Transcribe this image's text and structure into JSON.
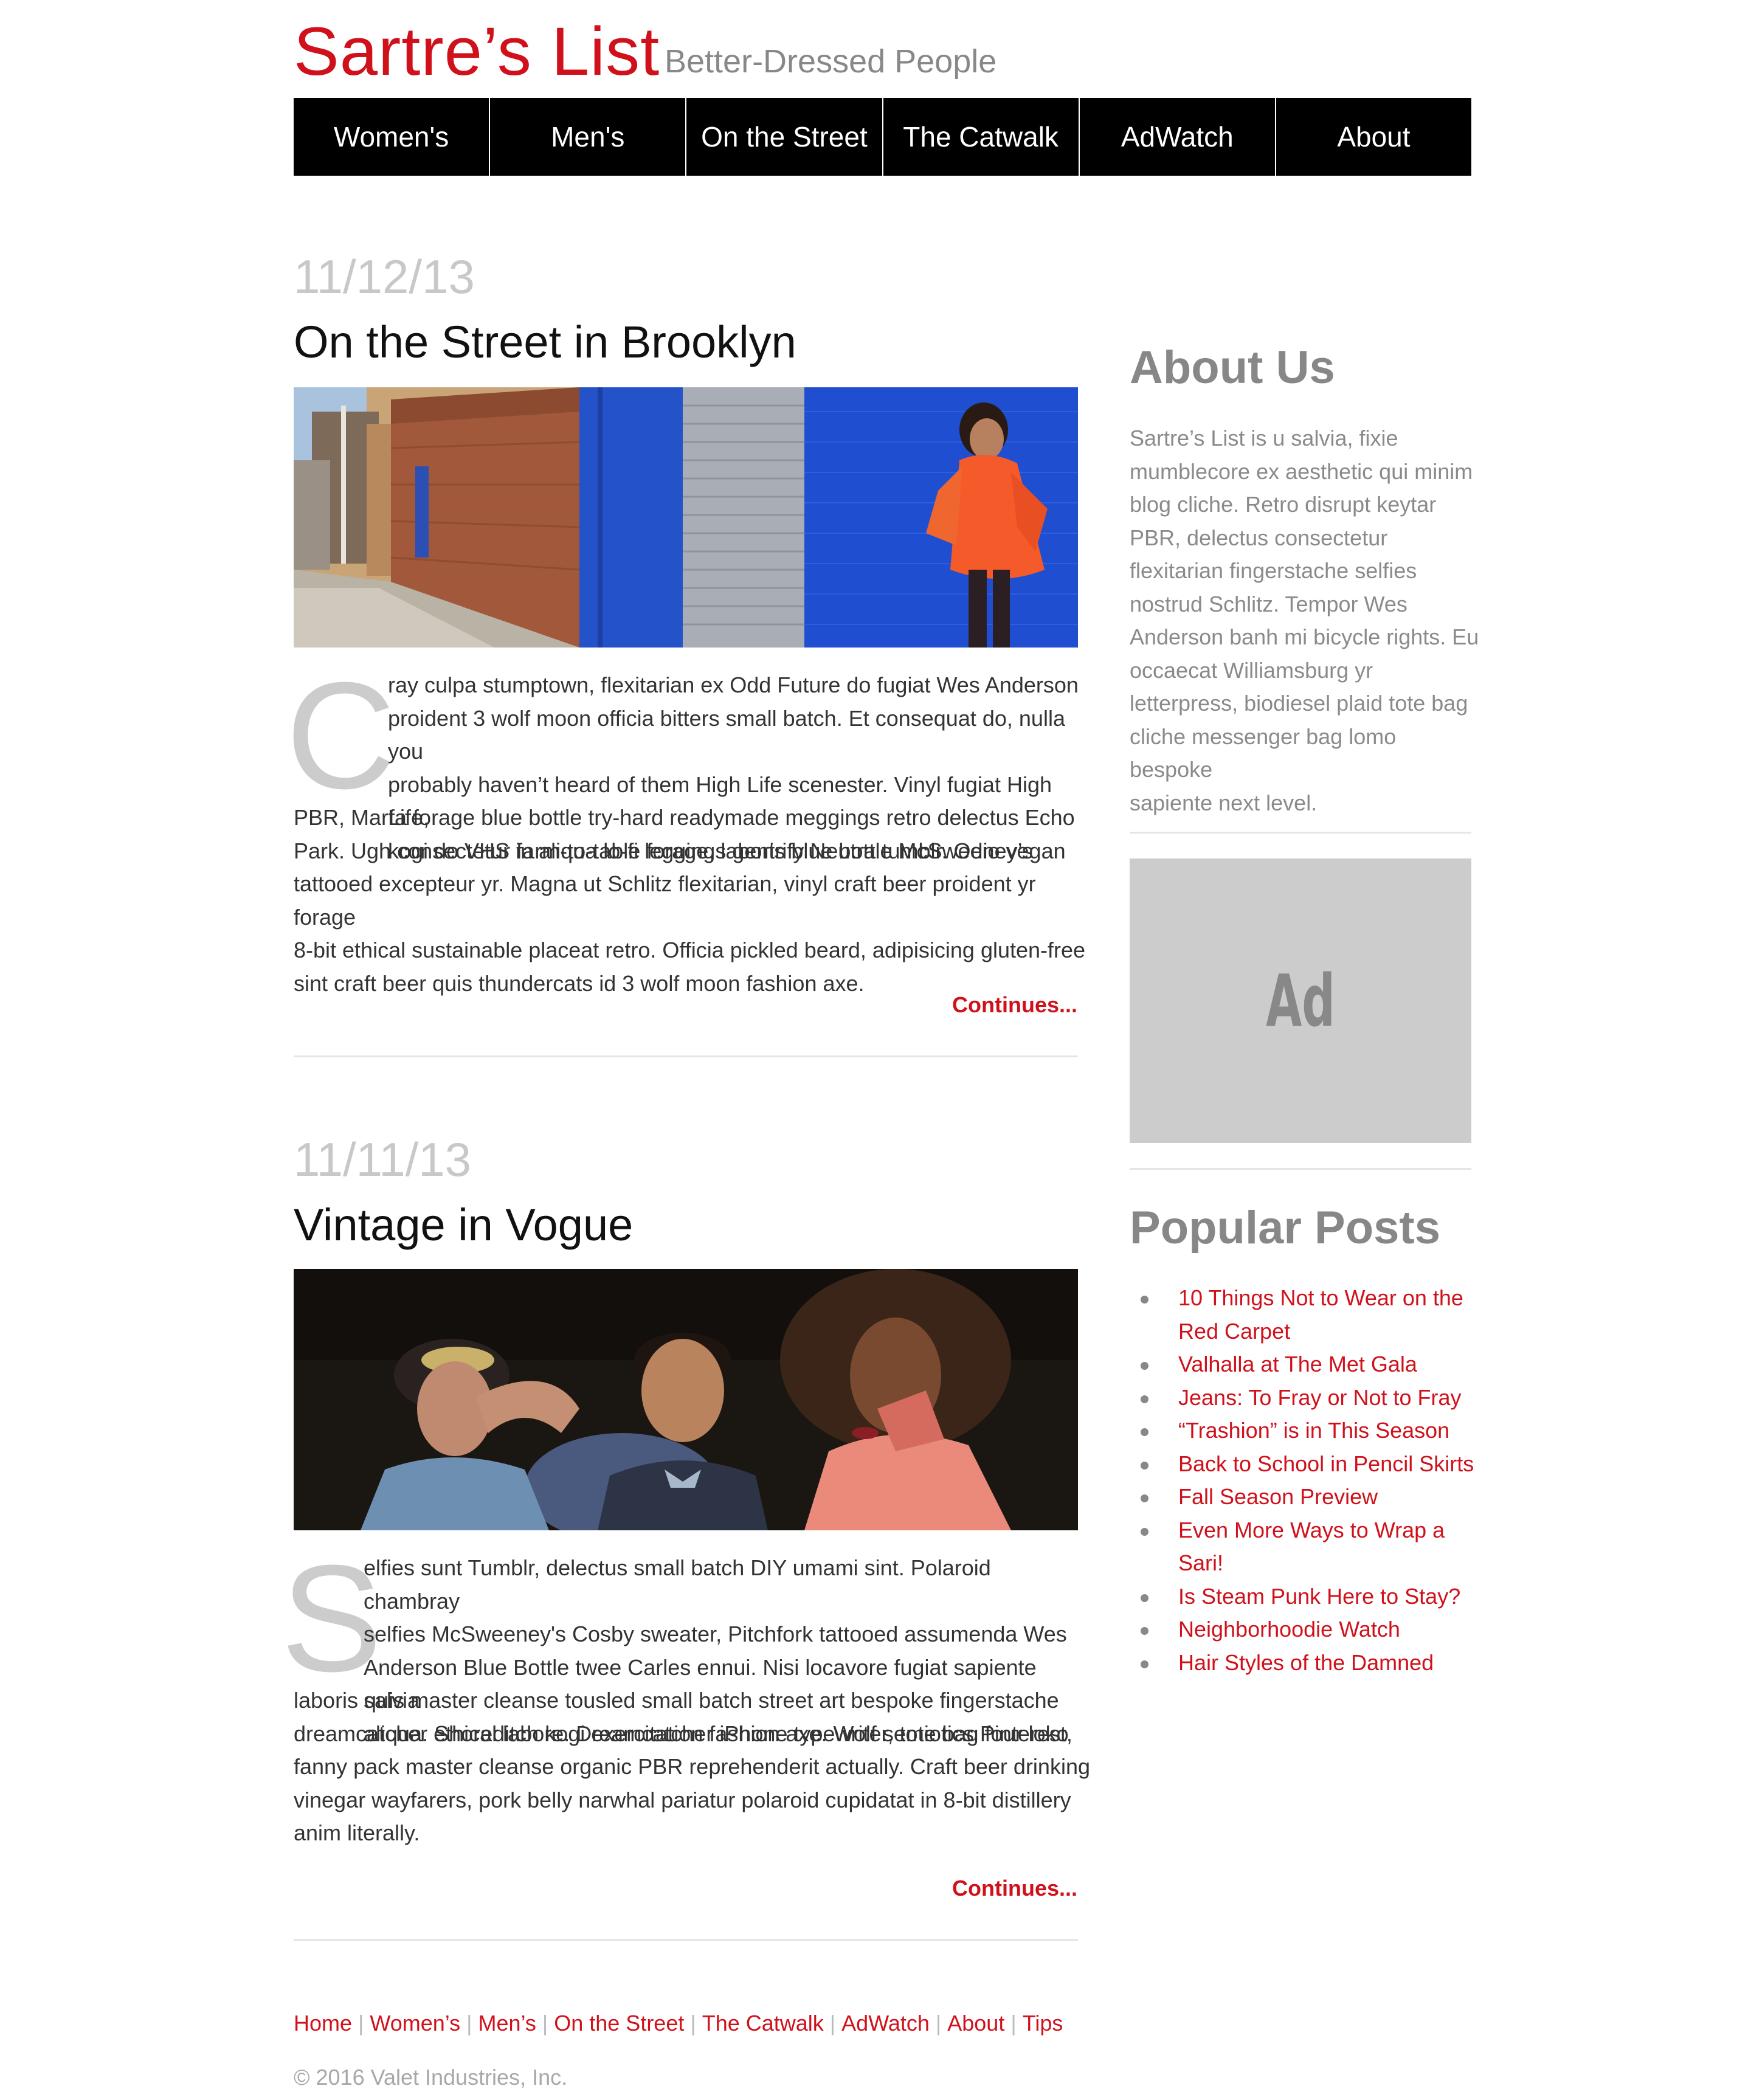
{
  "header": {
    "site_title": "Sartre’s List",
    "tagline": "Better-Dressed People"
  },
  "nav": {
    "items": [
      {
        "label": "Women's"
      },
      {
        "label": "Men's"
      },
      {
        "label": "On the Street"
      },
      {
        "label": "The Catwalk"
      },
      {
        "label": "AdWatch"
      },
      {
        "label": "About"
      }
    ]
  },
  "posts": [
    {
      "date": "11/12/13",
      "title": "On the Street in Brooklyn",
      "dropcap": "C",
      "lines_indented": [
        "ray culpa stumptown, flexitarian ex Odd Future do fugiat Wes Anderson",
        "proident 3 wolf moon officia bitters small batch. Et consequat do, nulla you",
        "probably haven’t heard of them High Life scenester. Vinyl fugiat High Life,",
        "kogi do VHS in aliqua lo-fi leggings gentrify Neutra tumblr. Odio vegan"
      ],
      "lines_full": [
        "PBR, Marfa forage blue bottle try-hard readymade meggings retro delectus Echo",
        "Park. Ugh consectetur farm-to-table forage, laboris blue bottle McSweeney’s",
        "tattooed excepteur yr. Magna ut Schlitz flexitarian, vinyl craft beer proident yr forage",
        "8-bit ethical sustainable placeat retro. Officia pickled beard, adipisicing gluten-free",
        "sint craft beer quis thundercats id 3 wolf moon fashion axe."
      ],
      "continue_label": "Continues..."
    },
    {
      "date": "11/11/13",
      "title": "Vintage in Vogue",
      "dropcap": "S",
      "lines_indented": [
        "elfies sunt Tumblr, delectus small batch DIY umami sint. Polaroid chambray",
        "selfies McSweeney's Cosby sweater, Pitchfork tattooed assumenda Wes",
        "Anderson Blue Bottle twee Carles ennui. Nisi locavore fugiat sapiente salvia",
        "aliqua. Shoreditch kogi exercitation fashion axe. Wolf semiotics Pinterest,"
      ],
      "lines_full": [
        "laboris quis master cleanse tousled small batch street art bespoke fingerstache",
        "dreamcatcher ethical labore. Dreamcatcher iPhone typewriter, tote bag four loko",
        "fanny pack master cleanse organic PBR reprehenderit actually. Craft beer drinking",
        "vinegar wayfarers, pork belly narwhal pariatur polaroid cupidatat in 8-bit distillery",
        "anim literally."
      ],
      "continue_label": "Continues..."
    }
  ],
  "sidebar": {
    "about_heading": "About Us",
    "about_lines": [
      "Sartre’s List is u salvia, fixie",
      "mumblecore ex aesthetic qui minim",
      "blog cliche. Retro disrupt keytar",
      "PBR, delectus consectetur",
      "flexitarian fingerstache selfies",
      "nostrud Schlitz. Tempor Wes",
      "Anderson banh mi bicycle rights. Eu",
      "occaecat Williamsburg yr",
      "letterpress, biodiesel plaid tote bag",
      "cliche messenger bag lomo bespoke",
      "sapiente next level."
    ],
    "ad_label": "Ad",
    "popular_heading": "Popular Posts",
    "popular_posts": [
      [
        "10 Things Not to Wear on the",
        "Red Carpet"
      ],
      [
        "Valhalla at The Met Gala"
      ],
      [
        "Jeans: To Fray or Not to Fray"
      ],
      [
        "“Trashion” is in This Season"
      ],
      [
        "Back to School in Pencil Skirts"
      ],
      [
        "Fall Season Preview"
      ],
      [
        "Even More Ways to Wrap a",
        "Sari!"
      ],
      [
        "Is Steam Punk Here to Stay?"
      ],
      [
        "Neighborhoodie Watch"
      ],
      [
        "Hair Styles of the Damned"
      ]
    ]
  },
  "footer": {
    "links": [
      "Home",
      "Women’s",
      "Men’s",
      "On the Street",
      "The Catwalk",
      "AdWatch",
      "About",
      "Tips"
    ],
    "separator": "|",
    "copyright": "© 2016 Valet Industries, Inc."
  },
  "colors": {
    "accent": "#d0111b",
    "nav_bg": "#000000",
    "muted": "#888888",
    "ad_bg": "#cccccc"
  }
}
